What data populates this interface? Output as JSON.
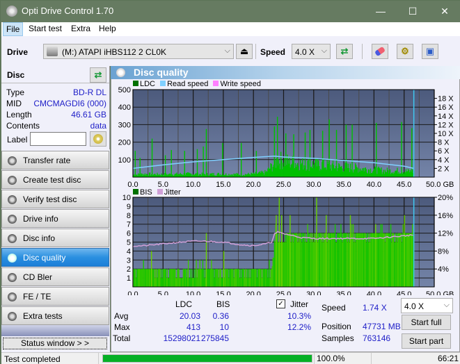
{
  "window": {
    "title": "Opti Drive Control 1.70",
    "minimize": "—",
    "maximize": "☐",
    "close": "✕"
  },
  "menu": [
    {
      "label": "File"
    },
    {
      "label": "Start test"
    },
    {
      "label": "Extra"
    },
    {
      "label": "Help"
    }
  ],
  "toolbar": {
    "drive_label": "Drive",
    "drive_value": "(M:)  ATAPI iHBS112  2 CL0K",
    "speed_label": "Speed",
    "speed_value": "4.0 X",
    "icons": [
      "eject-icon",
      "refresh-icon",
      "erase-icon",
      "settings-icon",
      "save-icon"
    ]
  },
  "disc": {
    "header": "Disc",
    "fields": [
      {
        "key": "Type",
        "value": "BD-R DL"
      },
      {
        "key": "MID",
        "value": "CMCMAGDI6 (000)"
      },
      {
        "key": "Length",
        "value": "46.61 GB"
      },
      {
        "key": "Contents",
        "value": "data"
      }
    ],
    "label_key": "Label",
    "label_value": ""
  },
  "nav": [
    {
      "label": "Transfer rate",
      "active": false
    },
    {
      "label": "Create test disc",
      "active": false
    },
    {
      "label": "Verify test disc",
      "active": false
    },
    {
      "label": "Drive info",
      "active": false
    },
    {
      "label": "Disc info",
      "active": false
    },
    {
      "label": "Disc quality",
      "active": true
    },
    {
      "label": "CD Bler",
      "active": false
    },
    {
      "label": "FE / TE",
      "active": false
    },
    {
      "label": "Extra tests",
      "active": false
    }
  ],
  "status_window_btn": "Status window > >",
  "panel_title": "Disc quality",
  "colors": {
    "ldc": "#00c000",
    "read_speed": "#80d0ff",
    "write_speed": "#ff80ff",
    "bis": "#00c000",
    "jitter": "#d0a0d8",
    "plot_bg_top": "#4c5a7c",
    "plot_bg_bottom": "#7484a8",
    "progress": "#06b025",
    "accent": "#2a8fe0"
  },
  "chart_data": [
    {
      "type": "bar",
      "title": "LDC",
      "legend": [
        "LDC",
        "Read speed",
        "Write speed"
      ],
      "legend_position": "top-left",
      "xlabel": "GB",
      "x_ticks": [
        "0.0",
        "5.0",
        "10.0",
        "15.0",
        "20.0",
        "25.0",
        "30.0",
        "35.0",
        "40.0",
        "45.0",
        "50.0 GB"
      ],
      "xlim": [
        0,
        50
      ],
      "y_ticks_left": [
        "500",
        "400",
        "300",
        "200",
        "100"
      ],
      "ylim_left": [
        0,
        500
      ],
      "y_ticks_right": [
        "18 X",
        "16 X",
        "14 X",
        "12 X",
        "10 X",
        "8 X",
        "6 X",
        "4 X",
        "2 X"
      ],
      "ylim_right": [
        0,
        20
      ],
      "grid": true,
      "end_marker_gb": 46.61,
      "series": [
        {
          "name": "LDC baseline",
          "x": [
            0,
            2,
            4,
            6,
            8,
            10,
            12,
            14,
            16,
            18,
            20,
            22,
            23,
            24,
            26,
            28,
            30,
            32,
            34,
            36,
            38,
            40,
            42,
            44,
            46.6
          ],
          "values": [
            15,
            20,
            18,
            18,
            20,
            20,
            18,
            20,
            18,
            18,
            20,
            30,
            70,
            110,
            95,
            85,
            80,
            75,
            65,
            60,
            55,
            45,
            40,
            40,
            35
          ]
        },
        {
          "name": "LDC spikes",
          "x": [
            0.3,
            1.1,
            3.1,
            5.3,
            6.3,
            8.5,
            10.6,
            11.6,
            12.1,
            14.8,
            17.9,
            20.4,
            23.4,
            23.9,
            25.3,
            26.6,
            28.5,
            29.3,
            31.4,
            32.5,
            33.7,
            35.3,
            36.3,
            40.3,
            44.5,
            46.2
          ],
          "values": [
            150,
            110,
            220,
            125,
            155,
            150,
            160,
            175,
            275,
            195,
            195,
            150,
            290,
            345,
            250,
            245,
            255,
            270,
            265,
            330,
            270,
            300,
            300,
            310,
            315,
            280
          ]
        },
        {
          "name": "Read speed",
          "x": [
            0,
            5,
            10,
            15,
            20,
            23.5,
            25,
            30,
            35,
            40,
            45,
            46.6
          ],
          "values": [
            2.0,
            2.8,
            3.5,
            4.0,
            4.5,
            4.8,
            4.6,
            4.3,
            3.8,
            3.3,
            2.5,
            2.0
          ]
        }
      ]
    },
    {
      "type": "bar",
      "title": "BIS",
      "legend": [
        "BIS",
        "Jitter"
      ],
      "legend_position": "top-left",
      "xlabel": "GB",
      "x_ticks": [
        "0.0",
        "5.0",
        "10.0",
        "15.0",
        "20.0",
        "25.0",
        "30.0",
        "35.0",
        "40.0",
        "45.0",
        "50.0 GB"
      ],
      "xlim": [
        0,
        50
      ],
      "y_ticks_left": [
        "10",
        "9",
        "8",
        "7",
        "6",
        "5",
        "4",
        "3",
        "2",
        "1"
      ],
      "ylim_left": [
        0,
        10
      ],
      "y_ticks_right": [
        "20%",
        "16%",
        "12%",
        "8%",
        "4%"
      ],
      "ylim_right": [
        0,
        20
      ],
      "grid": true,
      "end_marker_gb": 46.61,
      "series": [
        {
          "name": "BIS baseline",
          "x": [
            0,
            23,
            23.5,
            46.6
          ],
          "values": [
            2,
            2,
            6,
            6
          ]
        },
        {
          "name": "BIS spikes",
          "x": [
            3,
            12.1,
            15,
            23.7,
            24.2,
            24.6,
            26,
            30.4,
            32,
            36,
            40.2,
            45
          ],
          "values": [
            4,
            6,
            4,
            8,
            10,
            8,
            8,
            10,
            8,
            8,
            7,
            8
          ]
        },
        {
          "name": "Jitter %",
          "x": [
            0,
            2,
            5,
            8,
            10,
            12,
            15,
            18,
            20,
            22,
            23,
            23.5,
            24,
            26,
            28,
            30,
            35,
            40,
            45,
            46.6
          ],
          "values": [
            9.1,
            9.2,
            9.6,
            10.0,
            10.2,
            10.2,
            10.0,
            9.4,
            9.2,
            9.6,
            10.0,
            11.8,
            12.2,
            11.6,
            11.0,
            10.8,
            10.8,
            10.8,
            11.4,
            11.6
          ]
        }
      ]
    }
  ],
  "stats": {
    "col_ldc": "LDC",
    "col_bis": "BIS",
    "jitter_label": "Jitter",
    "jitter_checked": true,
    "rows": [
      {
        "label": "Avg",
        "ldc": "20.03",
        "bis": "0.36",
        "jitter": "10.3%"
      },
      {
        "label": "Max",
        "ldc": "413",
        "bis": "10",
        "jitter": "12.2%"
      },
      {
        "label": "Total",
        "ldc": "15298021",
        "bis": "275845",
        "jitter": ""
      }
    ],
    "speed_label": "Speed",
    "speed_value": "1.74 X",
    "position_label": "Position",
    "position_value": "47731 MB",
    "samples_label": "Samples",
    "samples_value": "763146",
    "speed_select": "4.0 X",
    "start_full": "Start full",
    "start_part": "Start part"
  },
  "status": {
    "text": "Test completed",
    "progress": 100.0,
    "progress_text": "100.0%",
    "time": "66:21"
  }
}
